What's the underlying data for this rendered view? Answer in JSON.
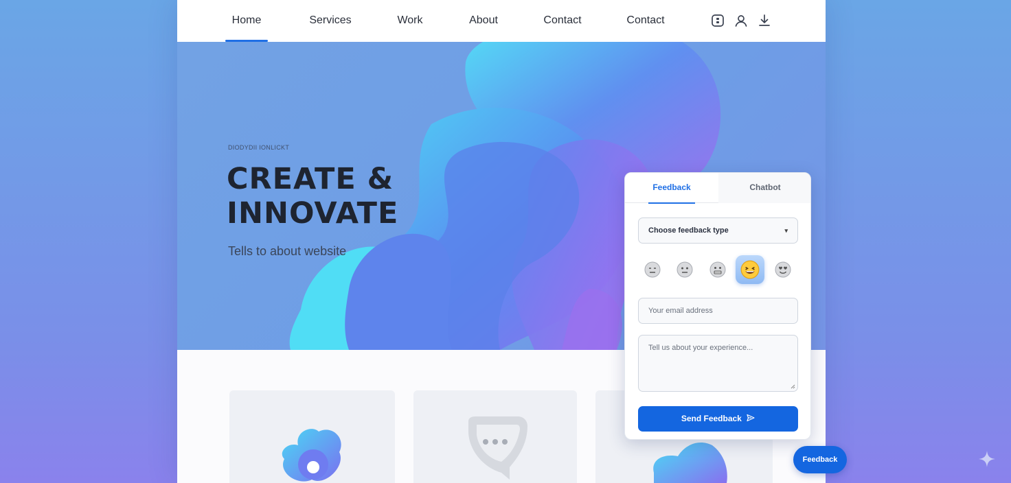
{
  "nav": {
    "items": [
      {
        "label": "Home",
        "active": true
      },
      {
        "label": "Services",
        "active": false
      },
      {
        "label": "Work",
        "active": false
      },
      {
        "label": "About",
        "active": false
      },
      {
        "label": "Contact",
        "active": false
      },
      {
        "label": "Contact",
        "active": false
      }
    ],
    "icons": [
      "app-square-icon",
      "user-icon",
      "download-icon"
    ]
  },
  "hero": {
    "eyebrow": "DIODYDII IONLICKT",
    "title_line1": "CREATE &",
    "title_line2": "INNOVATE",
    "subtitle": "Tells to about website"
  },
  "cards": {
    "icons": [
      "blob-flower-icon",
      "chat-bubble-icon",
      "blob-wave-icon"
    ]
  },
  "widget": {
    "tabs": [
      {
        "label": "Feedback",
        "active": true
      },
      {
        "label": "Chatbot",
        "active": false
      }
    ],
    "select": {
      "value": "Choose feedback type",
      "caret": "▾"
    },
    "emojis": [
      "😑",
      "😐",
      "😬",
      "😆",
      "😍"
    ],
    "selected_emoji_index": 3,
    "email": {
      "placeholder": "Your email address"
    },
    "message": {
      "placeholder": "Tell us about your experience..."
    },
    "send_label": "Send Feedback",
    "send_icon": "send-arrow-icon"
  },
  "fab_label": "Feedback",
  "colors": {
    "accent": "#1466e0",
    "hero_bg": "#72a2e4",
    "text_dark": "#1e2430"
  }
}
